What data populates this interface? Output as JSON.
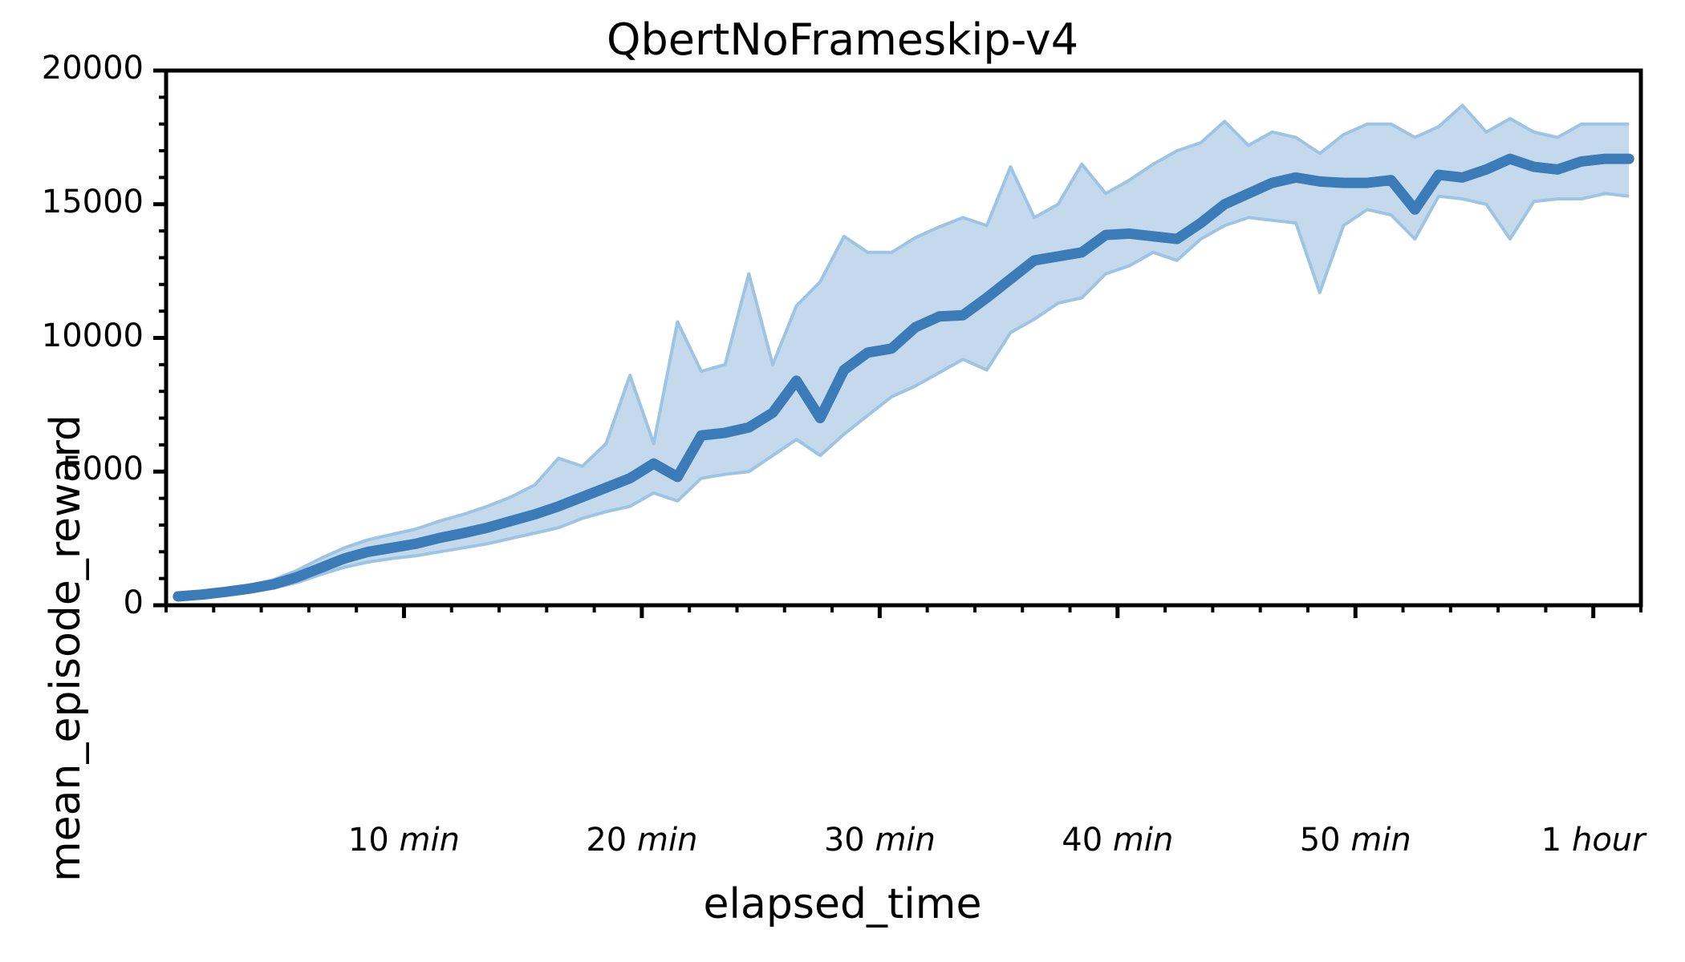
{
  "chart_data": {
    "type": "line",
    "title": "QbertNoFrameskip-v4",
    "xlabel": "elapsed_time",
    "ylabel": "mean_episode_reward",
    "grid": false,
    "legend": null,
    "colors": {
      "line": "#3b7cb8",
      "band_fill": "#c5d9ec",
      "band_edge": "#9ec4e3",
      "axis": "#000000",
      "background": "#ffffff"
    },
    "xlim_seconds": [
      0,
      3720
    ],
    "ylim": [
      0,
      20000
    ],
    "ytick_values": [
      0,
      5000,
      10000,
      15000,
      20000
    ],
    "ytick_labels": [
      "0",
      "5000",
      "10000",
      "15000",
      "20000"
    ],
    "xtick_seconds": [
      600,
      1200,
      1800,
      2400,
      3000,
      3600
    ],
    "xtick_labels": [
      {
        "value": "10",
        "unit": "min"
      },
      {
        "value": "20",
        "unit": "min"
      },
      {
        "value": "30",
        "unit": "min"
      },
      {
        "value": "40",
        "unit": "min"
      },
      {
        "value": "50",
        "unit": "min"
      },
      {
        "value": "1",
        "unit": "hour"
      }
    ],
    "x_seconds": [
      30,
      90,
      150,
      210,
      270,
      330,
      390,
      450,
      510,
      570,
      630,
      690,
      750,
      810,
      870,
      930,
      990,
      1050,
      1110,
      1170,
      1230,
      1290,
      1350,
      1410,
      1470,
      1530,
      1590,
      1650,
      1710,
      1770,
      1830,
      1890,
      1950,
      2010,
      2070,
      2130,
      2190,
      2250,
      2310,
      2370,
      2430,
      2490,
      2550,
      2610,
      2670,
      2730,
      2790,
      2850,
      2910,
      2970,
      3030,
      3090,
      3150,
      3210,
      3270,
      3330,
      3390,
      3450,
      3510,
      3570,
      3630,
      3690
    ],
    "series": [
      {
        "name": "mean_episode_reward",
        "values": [
          330,
          400,
          500,
          620,
          780,
          1050,
          1400,
          1750,
          2000,
          2150,
          2300,
          2520,
          2700,
          2900,
          3150,
          3400,
          3700,
          4050,
          4400,
          4750,
          5300,
          4800,
          6350,
          6450,
          6650,
          7200,
          8400,
          7000,
          8800,
          9450,
          9600,
          10400,
          10800,
          10850,
          11500,
          12200,
          12900,
          13050,
          13200,
          13850,
          13900,
          13800,
          13700,
          14300,
          15000,
          15400,
          15800,
          16000,
          15850,
          15800,
          15800,
          15900,
          14800,
          16100,
          16000,
          16300,
          16700,
          16400,
          16300,
          16600,
          16700,
          16700
        ]
      }
    ],
    "band_upper": [
      400,
      470,
      590,
      740,
      950,
      1300,
      1750,
      2150,
      2450,
      2650,
      2850,
      3150,
      3400,
      3700,
      4050,
      4500,
      5500,
      5200,
      6050,
      8600,
      6050,
      10600,
      8750,
      9000,
      12400,
      9000,
      11200,
      12100,
      13800,
      13200,
      13200,
      13750,
      14150,
      14500,
      14200,
      16400,
      14500,
      15000,
      16500,
      15400,
      15900,
      16500,
      17000,
      17300,
      18100,
      17200,
      17700,
      17500,
      16900,
      17600,
      18000,
      18000,
      17500,
      17900,
      18700,
      17700,
      18200,
      17700,
      17500,
      18000,
      18000,
      18000
    ],
    "band_lower": [
      280,
      330,
      410,
      510,
      640,
      850,
      1150,
      1420,
      1620,
      1750,
      1850,
      2000,
      2150,
      2300,
      2500,
      2700,
      2900,
      3250,
      3500,
      3700,
      4200,
      3900,
      4750,
      4900,
      5000,
      5600,
      6200,
      5600,
      6400,
      7100,
      7800,
      8200,
      8700,
      9200,
      8800,
      10200,
      10700,
      11300,
      11500,
      12400,
      12700,
      13200,
      12900,
      13700,
      14200,
      14500,
      14400,
      14300,
      11700,
      14200,
      14800,
      14600,
      13700,
      15300,
      15200,
      15000,
      13700,
      15100,
      15200,
      15200,
      15400,
      15300
    ]
  }
}
